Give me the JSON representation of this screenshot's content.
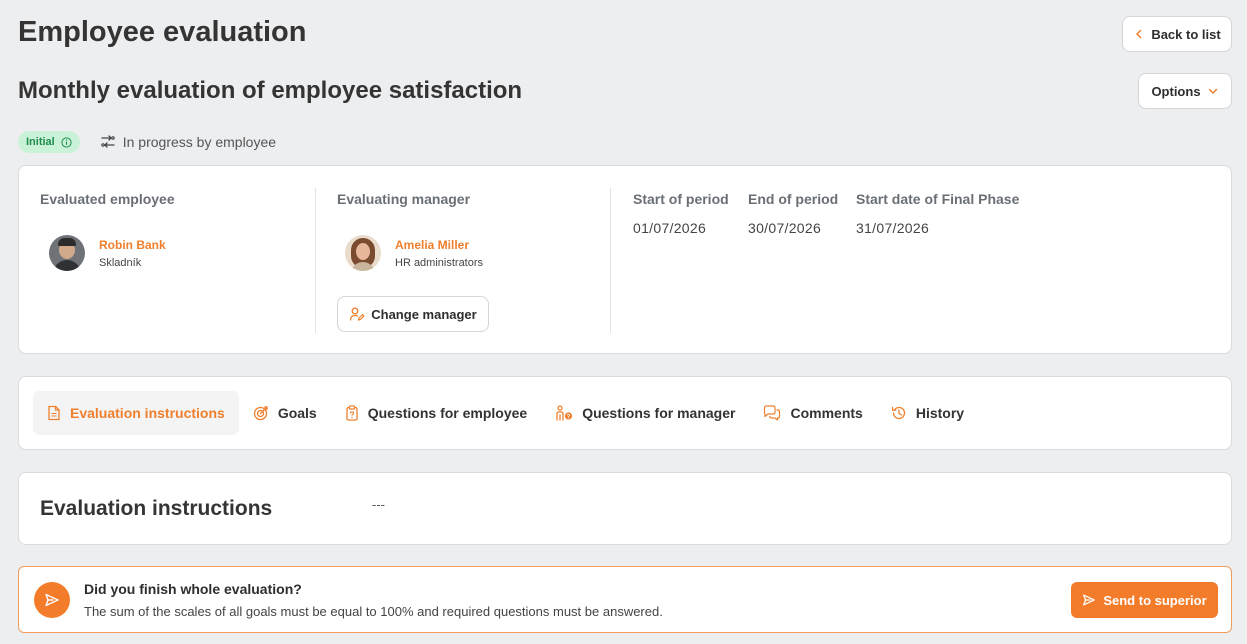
{
  "header": {
    "title": "Employee evaluation",
    "subtitle": "Monthly evaluation of employee satisfaction",
    "back_label": "Back to list",
    "options_label": "Options"
  },
  "status": {
    "badge": "Initial",
    "state": "In progress by employee",
    "badge_color": "#c9f2d8",
    "accent": "#ef7f2c"
  },
  "evaluated": {
    "label": "Evaluated employee",
    "name": "Robin Bank",
    "role": "Skladník"
  },
  "manager": {
    "label": "Evaluating manager",
    "name": "Amelia Miller",
    "role": "HR administrators",
    "change_label": "Change manager"
  },
  "period": {
    "start_label": "Start of period",
    "start": "01/07/2026",
    "end_label": "End of period",
    "end": "30/07/2026",
    "final_label": "Start date of Final Phase",
    "final": "31/07/2026"
  },
  "tabs": [
    {
      "label": "Evaluation instructions",
      "icon": "document-icon"
    },
    {
      "label": "Goals",
      "icon": "target-icon"
    },
    {
      "label": "Questions for employee",
      "icon": "clipboard-icon"
    },
    {
      "label": "Questions for manager",
      "icon": "person-question-icon"
    },
    {
      "label": "Comments",
      "icon": "comments-icon"
    },
    {
      "label": "History",
      "icon": "history-icon"
    }
  ],
  "instructions": {
    "title": "Evaluation instructions",
    "text": "---"
  },
  "footer": {
    "question": "Did you finish whole evaluation?",
    "text": "The sum of the scales of all goals must be equal to 100% and required questions must be answered.",
    "send_label": "Send to superior"
  }
}
